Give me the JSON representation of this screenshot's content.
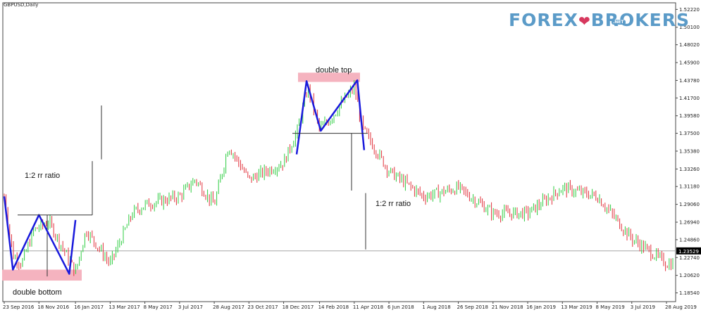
{
  "symbol_label": "GBPUSD,Daily",
  "logo": {
    "part1": "FOREX",
    "heart": "❤",
    "part2": "BROKERS",
    "badge": ".NET"
  },
  "annotations": {
    "double_top": "double top",
    "double_bottom": "double bottom",
    "rr_left": "1:2 rr ratio",
    "rr_right": "1:2 rr ratio"
  },
  "colors": {
    "up_candle": "#2ecc40",
    "down_candle": "#e0303a",
    "pattern_line": "#1a1adc",
    "zone": "#f5b3bf",
    "grid_line": "#999999"
  },
  "chart_data": {
    "type": "candlestick",
    "title": "GBPUSD,Daily",
    "current_price": "1.23529",
    "ylim": [
      1.175,
      1.53
    ],
    "y_ticks": [
      "1.52220",
      "1.50100",
      "1.48020",
      "1.45900",
      "1.43780",
      "1.41700",
      "1.39580",
      "1.37500",
      "1.35380",
      "1.33260",
      "1.31180",
      "1.29060",
      "1.26940",
      "1.24860",
      "1.22740",
      "1.20620",
      "1.18540"
    ],
    "x_ticks": [
      "23 Sep 2016",
      "18 Nov 2016",
      "16 Jan 2017",
      "13 Mar 2017",
      "8 May 2017",
      "3 Jul 2017",
      "28 Aug 2017",
      "23 Oct 2017",
      "18 Dec 2017",
      "14 Feb 2018",
      "11 Apr 2018",
      "6 Jun 2018",
      "1 Aug 2018",
      "26 Sep 2018",
      "21 Nov 2018",
      "16 Jan 2019",
      "13 Mar 2019",
      "8 May 2019",
      "3 Jul 2019",
      "28 Aug 2019"
    ],
    "price_path": [
      {
        "date": "23 Sep 2016",
        "price": 1.3
      },
      {
        "date": "7 Oct 2016",
        "price": 1.23
      },
      {
        "date": "21 Oct 2016",
        "price": 1.22
      },
      {
        "date": "10 Nov 2016",
        "price": 1.26
      },
      {
        "date": "4 Dec 2016",
        "price": 1.27
      },
      {
        "date": "16 Jan 2017",
        "price": 1.21
      },
      {
        "date": "2 Feb 2017",
        "price": 1.26
      },
      {
        "date": "13 Mar 2017",
        "price": 1.22
      },
      {
        "date": "18 Apr 2017",
        "price": 1.28
      },
      {
        "date": "8 May 2017",
        "price": 1.29
      },
      {
        "date": "3 Jul 2017",
        "price": 1.3
      },
      {
        "date": "28 Jul 2017",
        "price": 1.32
      },
      {
        "date": "28 Aug 2017",
        "price": 1.29
      },
      {
        "date": "20 Sep 2017",
        "price": 1.36
      },
      {
        "date": "23 Oct 2017",
        "price": 1.32
      },
      {
        "date": "18 Dec 2017",
        "price": 1.34
      },
      {
        "date": "10 Jan 2018",
        "price": 1.38
      },
      {
        "date": "26 Jan 2018",
        "price": 1.43
      },
      {
        "date": "14 Feb 2018",
        "price": 1.38
      },
      {
        "date": "1 Mar 2018",
        "price": 1.39
      },
      {
        "date": "11 Apr 2018",
        "price": 1.43
      },
      {
        "date": "25 Apr 2018",
        "price": 1.38
      },
      {
        "date": "6 Jun 2018",
        "price": 1.33
      },
      {
        "date": "1 Aug 2018",
        "price": 1.3
      },
      {
        "date": "26 Sep 2018",
        "price": 1.31
      },
      {
        "date": "21 Nov 2018",
        "price": 1.28
      },
      {
        "date": "16 Jan 2019",
        "price": 1.28
      },
      {
        "date": "13 Mar 2019",
        "price": 1.31
      },
      {
        "date": "8 May 2019",
        "price": 1.3
      },
      {
        "date": "3 Jul 2019",
        "price": 1.25
      },
      {
        "date": "28 Aug 2019",
        "price": 1.22
      }
    ],
    "double_bottom": {
      "points": [
        {
          "date": "23 Sep 2016",
          "price": 1.3
        },
        {
          "date": "7 Oct 2016",
          "price": 1.213
        },
        {
          "date": "18 Nov 2016",
          "price": 1.278
        },
        {
          "date": "6 Jan 2017",
          "price": 1.208
        },
        {
          "date": "16 Jan 2017",
          "price": 1.272
        }
      ],
      "neckline": 1.278,
      "zone": [
        1.2,
        1.213
      ]
    },
    "double_top": {
      "points": [
        {
          "date": "8 Jan 2018",
          "price": 1.35
        },
        {
          "date": "24 Jan 2018",
          "price": 1.437
        },
        {
          "date": "16 Feb 2018",
          "price": 1.378
        },
        {
          "date": "16 Apr 2018",
          "price": 1.438
        },
        {
          "date": "27 Apr 2018",
          "price": 1.355
        }
      ],
      "neckline": 1.375,
      "zone": [
        1.436,
        1.447
      ]
    }
  }
}
